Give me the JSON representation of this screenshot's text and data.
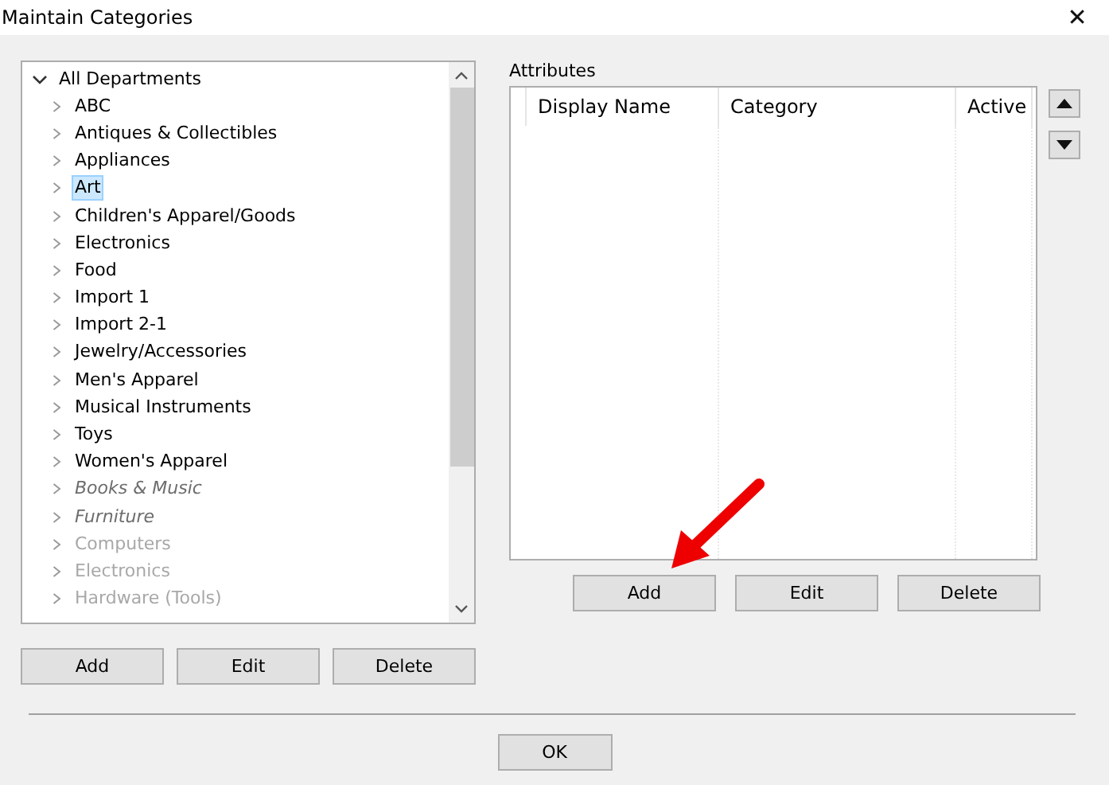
{
  "window": {
    "title": "Maintain Categories",
    "close": "✕"
  },
  "tree": {
    "root": {
      "label": "All Departments",
      "expanded": true,
      "children": [
        {
          "label": "ABC",
          "selected": false,
          "inactive": false,
          "disabled": false
        },
        {
          "label": "Antiques & Collectibles",
          "selected": false,
          "inactive": false,
          "disabled": false
        },
        {
          "label": "Appliances",
          "selected": false,
          "inactive": false,
          "disabled": false
        },
        {
          "label": "Art",
          "selected": true,
          "inactive": false,
          "disabled": false
        },
        {
          "label": "Children's Apparel/Goods",
          "selected": false,
          "inactive": false,
          "disabled": false
        },
        {
          "label": "Electronics",
          "selected": false,
          "inactive": false,
          "disabled": false
        },
        {
          "label": "Food",
          "selected": false,
          "inactive": false,
          "disabled": false
        },
        {
          "label": "Import 1",
          "selected": false,
          "inactive": false,
          "disabled": false
        },
        {
          "label": "Import 2-1",
          "selected": false,
          "inactive": false,
          "disabled": false
        },
        {
          "label": "Jewelry/Accessories",
          "selected": false,
          "inactive": false,
          "disabled": false
        },
        {
          "label": "Men's Apparel",
          "selected": false,
          "inactive": false,
          "disabled": false
        },
        {
          "label": "Musical Instruments",
          "selected": false,
          "inactive": false,
          "disabled": false
        },
        {
          "label": "Toys",
          "selected": false,
          "inactive": false,
          "disabled": false
        },
        {
          "label": "Women's Apparel",
          "selected": false,
          "inactive": false,
          "disabled": false
        },
        {
          "label": "Books & Music",
          "selected": false,
          "inactive": true,
          "disabled": false
        },
        {
          "label": "Furniture",
          "selected": false,
          "inactive": true,
          "disabled": false
        },
        {
          "label": "Computers",
          "selected": false,
          "inactive": false,
          "disabled": true
        },
        {
          "label": "Electronics",
          "selected": false,
          "inactive": false,
          "disabled": true
        },
        {
          "label": "Hardware (Tools)",
          "selected": false,
          "inactive": false,
          "disabled": true
        }
      ]
    }
  },
  "tree_buttons": [
    "Add",
    "Edit",
    "Delete"
  ],
  "attributes": {
    "label": "Attributes",
    "columns": [
      "Display Name",
      "Category",
      "Active"
    ]
  },
  "attribute_buttons": [
    "Add",
    "Edit",
    "Delete"
  ],
  "ok_button": "OK"
}
